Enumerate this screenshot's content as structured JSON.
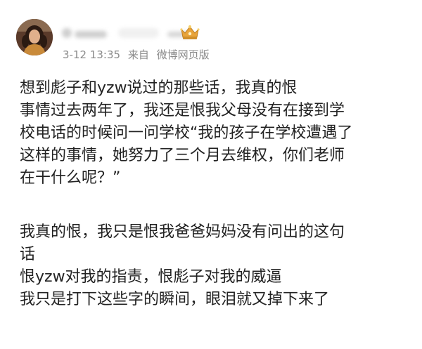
{
  "header": {
    "timestamp": "3-12 13:35",
    "source_prefix": "来自",
    "source": "微博网页版",
    "avatar_icon": "avatar-photo",
    "badge_icon": "crown-icon",
    "badge_color": "#e8a43a"
  },
  "post": {
    "paragraph1": [
      "想到彪子和yzw说过的那些话，我真的恨",
      "事情过去两年了，我还是恨我父母没有在接到学",
      "校电话的时候问一问学校“我的孩子在学校遭遇了",
      "这样的事情，她努力了三个月去维权，你们老师",
      "在干什么呢？”"
    ],
    "paragraph2": [
      "我真的恨，我只是恨我爸爸妈妈没有问出的这句",
      "话",
      "恨yzw对我的指责，恨彪子对我的威逼",
      "我只是打下这些字的瞬间，眼泪就又掉下来了"
    ]
  }
}
